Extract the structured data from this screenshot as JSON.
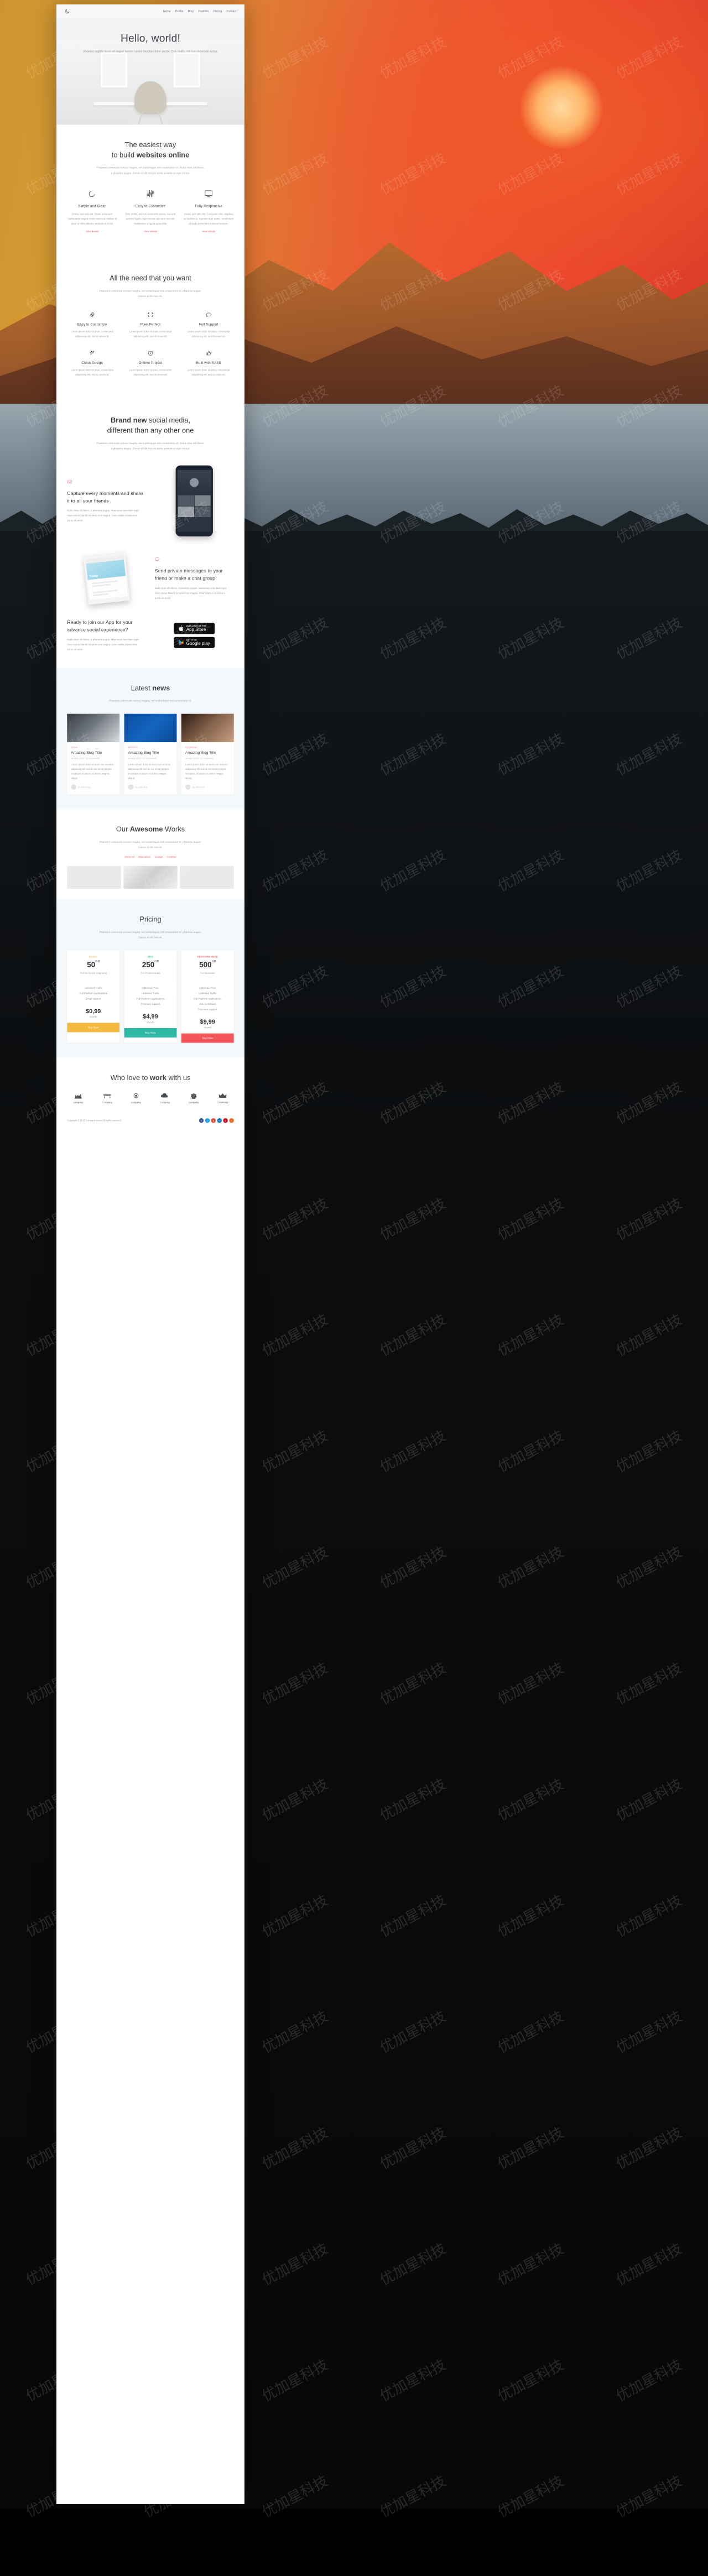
{
  "nav": {
    "logo_icon": "moon-icon",
    "links": [
      "Home",
      "Profile",
      "Blog",
      "Portfolio",
      "Pricing",
      "Contact"
    ]
  },
  "hero": {
    "title": "Hello, world!",
    "subtitle": "Vivamus sagittis lacus vel augue laoreet rutrum faucibus dolor auctor. Duis mollis, est non commodo luctus."
  },
  "easiest": {
    "title_line1": "The easiest way",
    "title_line2_light": "to build ",
    "title_line2_bold": "websites online",
    "subtitle": "Praesent commodo cursus magna, vel scelerisque nisl consectetur et. Nulla vitae elit libero, a pharetra augue. Donec id elit non mi porta gravida at eget metus.",
    "columns": [
      {
        "icon": "moon-icon",
        "title": "Simple and Clean",
        "text": "Donec sed odio dui. Etiam porta sem malesuada magna mollis euismod. Nullam id dolor id nibh ultricies vehicula ut id elit.",
        "link": "View details"
      },
      {
        "icon": "sliders-icon",
        "title": "Easy to Customize",
        "text": "Duis mollis, est non commodo luctus, nisi erat porttitor ligula, eget lacinia odio sem nec elit. Vestibulum id ligula porta felis.",
        "link": "View details"
      },
      {
        "icon": "monitor-icon",
        "title": "Fully Responsive",
        "text": "Donec sed odio dui. Cras justo odio, dapibus ac facilisis in, egestas eget quam. Vestibulum id ligula porta felis euismod semper.",
        "link": "View details"
      }
    ]
  },
  "needs": {
    "title": "All the need that you want",
    "subtitle": "Praesent commodo cursus magna, vel scelerisque nisl consectetur et. pharetra augue. Donec id elit non mi.",
    "items": [
      {
        "icon": "gear-icon",
        "title": "Easy to Customize",
        "text": "Lorem ipsum dolor sit amet, consectetur adipisicing elit, sed do eiusmod."
      },
      {
        "icon": "crop-icon",
        "title": "Pixel Perfect",
        "text": "Lorem ipsum dolor sit amet, consectetur adipisicing elit, sed do eiusmod."
      },
      {
        "icon": "chat-icon",
        "title": "Full Support",
        "text": "Lorem ipsum dolor sit amet, consectetur adipisicing elit, sed do eiusmod."
      },
      {
        "icon": "wand-icon",
        "title": "Clean Design",
        "text": "Lorem ipsum dolor sit amet, consectetur adipisicing elit, sed do eiusmod."
      },
      {
        "icon": "clock-icon",
        "title": "Ontime Project",
        "text": "Lorem ipsum dolor sit amet, consectetur adipisicing elit, sed do eiusmod."
      },
      {
        "icon": "thumbsup-icon",
        "title": "Built with SASS",
        "text": "Lorem ipsum dolor sit amet, consectetur adipisicing elit, sed do eiusmod."
      }
    ]
  },
  "brand": {
    "title_bold": "Brand new",
    "title_light": " social media,",
    "title_line2": "different than any other one",
    "subtitle": "Praesent commodo cursus magna, vel scelerisque nisl consectetur et. Nulla vitae elit libero, a pharetra augue. Donec id elit non mi porta gravida at eget metus.",
    "feature1": {
      "icon": "camera-icon",
      "title": "Capture every moments and share it to all your friends",
      "text": "Nulla vitae elit libero, a pharetra augue. Maecenas sed diam eget risus varius blandit sit amet non magna. Cras mattis consectetur purus sit amet."
    },
    "feature2": {
      "icon": "chat-icon",
      "title": "Send private messages to your friend or make a chat group",
      "text": "Nulla vitae elit libero, a pharetra augue. Maecenas sed diam eget risus varius blandit sit amet non magna. Cras mattis consectetur purus sit amet."
    },
    "cta": {
      "title": "Ready to join our App for your advance social experience?",
      "text": "Nulla vitae elit libero, a pharetra augue. Maecenas sed diam eget risus varius blandit sit amet non magna. Cras mattis consectetur purus sit amet.",
      "appstore_small": "AVAILABLE ON THE",
      "appstore_big": "App Store",
      "googleplay_small": "GET IT ON",
      "googleplay_big": "Google play"
    },
    "tablet_label": "Today"
  },
  "news": {
    "title_light": "Latest ",
    "title_bold": "news",
    "subtitle": "Praesent commodo cursus magna, vel scelerisque nisl consectetur et.",
    "cards": [
      {
        "category": "CODE",
        "title": "Amazing Blog Title",
        "meta": "30 May 2016 / 23 Comments",
        "text": "Lorem ipsum dolor sit amet con sectetur adipiscing elit sed do eiu smod tempor incididunt ut labore et dolore magna aliqua.",
        "author": "by John Doe"
      },
      {
        "category": "SPORTS",
        "title": "Amazing Blog Title",
        "meta": "30 May 2016 / 23 Comments",
        "text": "Lorem ipsum dolor sit amet con sectetur adipiscing elit sed do eiu smod tempor incididunt ut labore et dolore magna aliqua.",
        "author": "by John Doe"
      },
      {
        "category": "ECONOMY",
        "title": "Amazing Blog Title",
        "meta": "30 May 2016 / 23 Comments",
        "text": "Lorem ipsum dolor sit amet con sectetur adipiscing elit sed do eiu smod tempor incididunt ut labore et dolore magna aliqua.",
        "author": "by John Doe"
      }
    ]
  },
  "works": {
    "title_light1": "Our ",
    "title_bold": "Awesome",
    "title_light2": " Works",
    "subtitle": "Praesent commodo cursus magna, vel scelerisque nisl consectetur et. pharetra augue. Donec id elit non mi.",
    "filters": [
      "Show All",
      "Minimalism",
      "Vintage",
      "Creative"
    ]
  },
  "pricing": {
    "title": "Pricing",
    "subtitle": "Praesent commodo cursus magna, vel scelerisque nisl consectetur et. pharetra augue. Donec id elit non mi.",
    "plans": [
      {
        "tag": "BASIC",
        "tag_color": "#f5b942",
        "amount": "50",
        "unit": "GB",
        "for": "Perfect for the beginning",
        "features": [
          "Unlimited Traffic",
          "Full Platform Applications",
          "Email support"
        ],
        "price": "$0,99",
        "per": "/month",
        "button": "Buy Now",
        "button_color": "#f5b942"
      },
      {
        "tag": "PRO",
        "tag_color": "#2fb8a5",
        "amount": "250",
        "unit": "GB",
        "for": "For Professionals",
        "features": [
          "1 Domain Free",
          "Unlimited Traffic",
          "Full Platform Applications",
          "Premium support"
        ],
        "price": "$4,99",
        "per": "/month",
        "button": "Buy Now",
        "button_color": "#2fb8a5"
      },
      {
        "tag": "PERFORMANCE",
        "tag_color": "#f2555a",
        "amount": "500",
        "unit": "GB",
        "for": "For Business",
        "features": [
          "1 Domain Free",
          "Unlimited Traffic",
          "Full Platform Applications",
          "SSL Certificate",
          "Premium support"
        ],
        "price": "$9,99",
        "per": "/month",
        "button": "Buy Now",
        "button_color": "#f2555a"
      }
    ]
  },
  "clients": {
    "title_light": "Who love to ",
    "title_bold": "work",
    "title_light2": " with us",
    "logos": [
      {
        "icon": "factory-icon",
        "name": "company"
      },
      {
        "icon": "bench-icon",
        "name": "Company"
      },
      {
        "icon": "circle-icon",
        "name": "company"
      },
      {
        "icon": "cloud-icon",
        "name": "Company"
      },
      {
        "icon": "badge-icon",
        "name": "Company"
      },
      {
        "icon": "crown-icon",
        "name": "COMPANY"
      }
    ]
  },
  "footer": {
    "copyright": "Copyright © 2015 Company name All rights reserved.",
    "socials": [
      {
        "name": "facebook-icon",
        "glyph": "f",
        "color": "#3b5998"
      },
      {
        "name": "twitter-icon",
        "glyph": "t",
        "color": "#1da1f2"
      },
      {
        "name": "google-icon",
        "glyph": "g",
        "color": "#dd4b39"
      },
      {
        "name": "linkedin-icon",
        "glyph": "in",
        "color": "#0077b5"
      },
      {
        "name": "pinterest-icon",
        "glyph": "p",
        "color": "#bd081c"
      },
      {
        "name": "rss-icon",
        "glyph": "r",
        "color": "#f26522"
      }
    ]
  },
  "watermark": {
    "text": "优加星科技"
  },
  "colors": {
    "accent": "#ec5f6d",
    "dark": "#3c3f43",
    "muted": "#9aa0a6"
  }
}
